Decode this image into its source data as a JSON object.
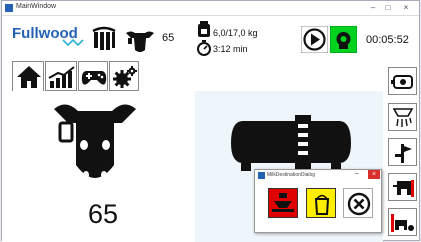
{
  "window": {
    "title": "MainWindow"
  },
  "header": {
    "brand": "Fullwood",
    "cow_number": "65",
    "milk_amount": "6,0/17,0 kg",
    "milk_time": "3:12 min",
    "clock": "00:05:52"
  },
  "main": {
    "cow_number": "65"
  },
  "dialog": {
    "title": "MilkDestinationDialog"
  },
  "colors": {
    "brand": "#2463b4",
    "play_green": "#00d21e",
    "red": "#e00000",
    "yellow": "#ffee00"
  }
}
